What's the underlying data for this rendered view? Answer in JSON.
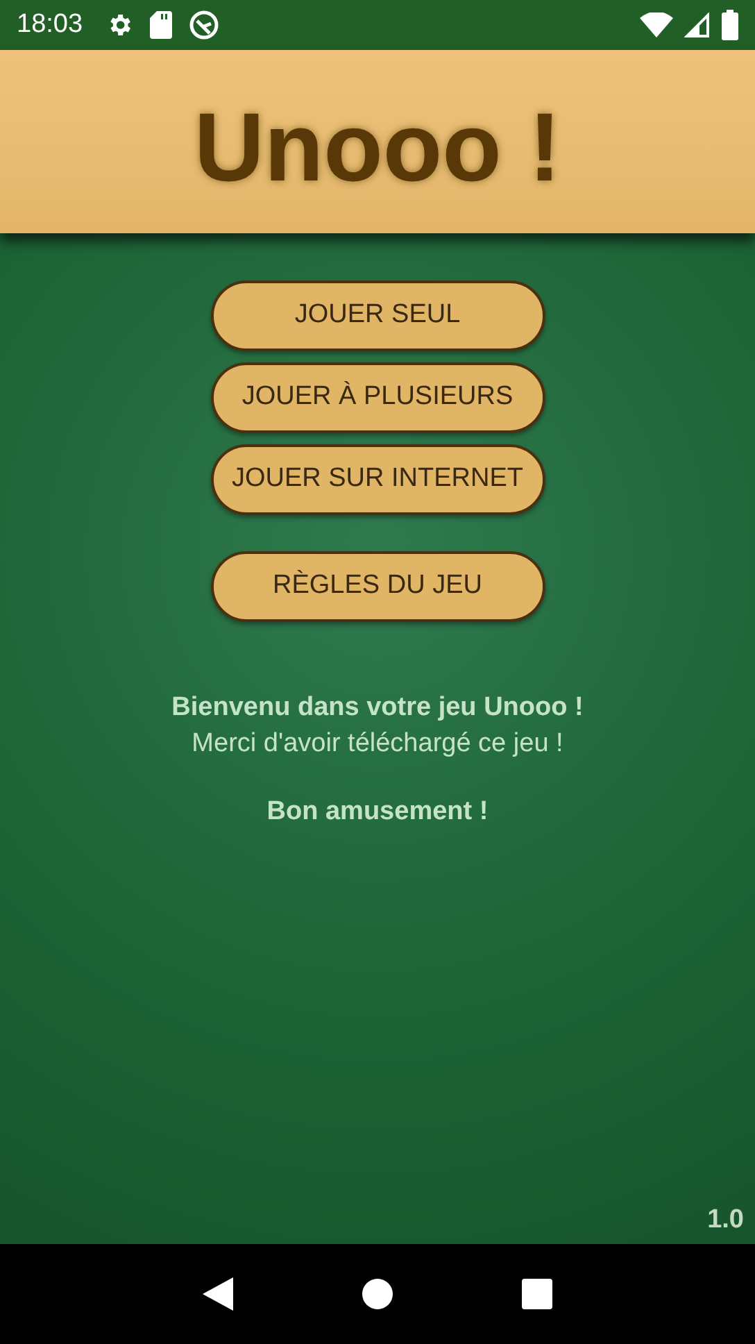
{
  "status_bar": {
    "time": "18:03"
  },
  "title": "Unooo !",
  "play_buttons": [
    {
      "label": "JOUER SEUL"
    },
    {
      "label": "JOUER À PLUSIEURS"
    },
    {
      "label": "JOUER SUR INTERNET"
    }
  ],
  "other_buttons": [
    {
      "label": "RÈGLES DU JEU"
    }
  ],
  "welcome": [
    {
      "text": "Bienvenu dans votre jeu Unooo !",
      "bold": true
    },
    {
      "text": "Merci d'avoir téléchargé ce jeu !",
      "bold": false
    }
  ],
  "closing": "Bon amusement !",
  "version": "1.0"
}
